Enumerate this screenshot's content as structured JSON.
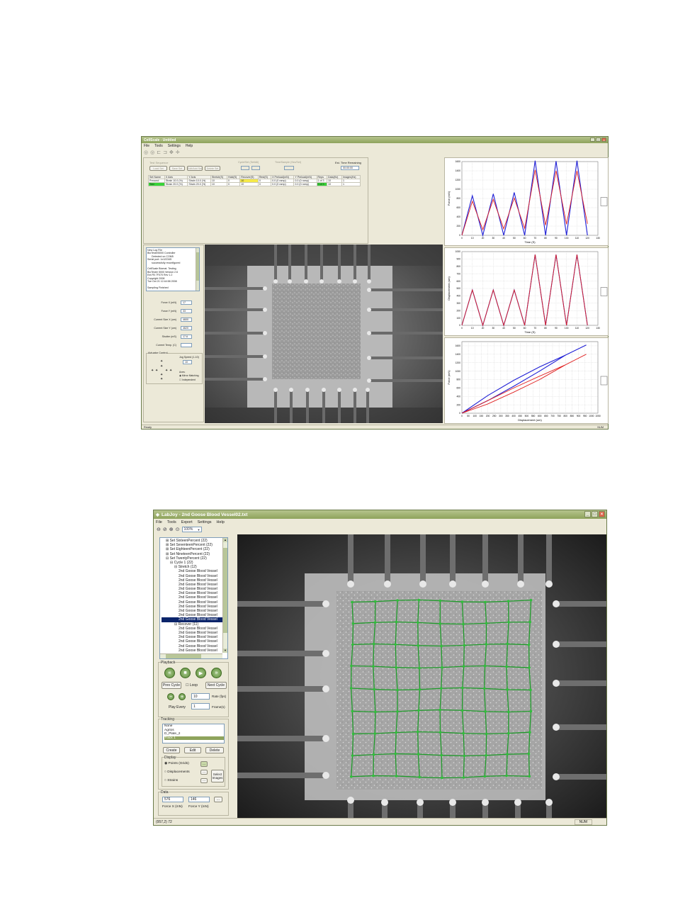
{
  "top_window": {
    "title": "CellScale - Untitled",
    "menu": [
      "File",
      "Tools",
      "Settings",
      "Help"
    ],
    "status": "Ready",
    "status_right": "NUM",
    "header_labels": {
      "test_sequence": "Test Sequence",
      "load_set": "Load Set",
      "save_set": "Save Set",
      "edit_set": "Edit/Add Set",
      "delete_set": "Delete Set",
      "cycle_label": "Cycle/Set (Set/All)",
      "time_label": "Time/Sample (Sec/Set)",
      "est_time_label": "Est. Time Remaining",
      "est_time_value": "00:00:00"
    },
    "table": {
      "headers": [
        "Set Name",
        "X Axis",
        "Y Axis",
        "Stretch(S)",
        "Hold(S)",
        "Recover(S)",
        "Rest(S)",
        "X Preload(mN)",
        "Y Preload(mN)",
        "Reps",
        "Data(Hz)",
        "Images(Hz)"
      ],
      "rows": [
        [
          "Precond",
          "Strain 10.0 (%)",
          "Strain 10.0 (%)",
          "10",
          "0",
          "10",
          "0",
          "0.0 (0 ramp)",
          "0.0 (0 ramp)",
          "1 of 3",
          "10",
          "1"
        ],
        [
          "Test",
          "Strain 20.0 (%)",
          "Strain 20.0 (%)",
          "10",
          "0",
          "10",
          "0",
          "0.0 (0 ramp)",
          "0.0 (0 ramp)",
          "0 of 3",
          "10",
          "1"
        ]
      ]
    },
    "log_lines": [
      "New Log File",
      "BioTester5000 Controller",
      "Detected on COM5",
      "Serial port: 1x122345",
      "successfully reconfigured",
      "",
      "CellScale Biomat. Testing",
      "BioTester 5000 Version 2.6",
      "Ext.FB 7F070 Rev 1.2",
      "Copyright 2008",
      "Tue Oct 21 12:44:58 2008",
      "",
      "Sampling Finished"
    ],
    "readouts": [
      {
        "label": "Force X (mN)",
        "value": "17"
      },
      {
        "label": "Force Y (mN)",
        "value": "33"
      },
      {
        "label": "Current Size X (um)",
        "value": "4600"
      },
      {
        "label": "Current Size Y (um)",
        "value": "4620"
      },
      {
        "label": "Shutter (mS)",
        "value": "17.6"
      },
      {
        "label": "Current Temp. (C)",
        "value": ""
      }
    ],
    "actuator": {
      "title": "Actuator Control",
      "jog_label": "Jog Speed (1-10)",
      "jog_value": "10",
      "axes_label": "Axes:",
      "option_mirror": "Mirror Matching",
      "option_independent": "Independent"
    },
    "charts": {
      "force": {
        "ylabel": "Force (mN)",
        "xlabel": "Time (S)"
      },
      "disp": {
        "ylabel": "Displacement (um)",
        "xlabel": "Time (S)"
      },
      "fvd": {
        "ylabel": "Force (mN)",
        "xlabel": "Displacement (um)"
      }
    }
  },
  "bottom_window": {
    "title": "LabJoy - 2nd Goose Blood Vessel02.txt",
    "menu": [
      "File",
      "Tools",
      "Export",
      "Settings",
      "Help"
    ],
    "zoom": "100%",
    "tree": [
      {
        "text": "Set SixteenPercent (22)",
        "indent": 1,
        "sel": false
      },
      {
        "text": "Set SeventeenPercent (22)",
        "indent": 1,
        "sel": false
      },
      {
        "text": "Set EighteenPercent (22)",
        "indent": 1,
        "sel": false
      },
      {
        "text": "Set NineteenPercent (22)",
        "indent": 1,
        "sel": false
      },
      {
        "text": "Set TwentyPercent (22)",
        "indent": 1,
        "sel": false
      },
      {
        "text": "Cycle 1 (22)",
        "indent": 2,
        "sel": false
      },
      {
        "text": "Stretch (12)",
        "indent": 3,
        "sel": false
      },
      {
        "text": "2nd Goose Blood Vessel",
        "indent": 4,
        "sel": false
      },
      {
        "text": "2nd Goose Blood Vessel",
        "indent": 4,
        "sel": false
      },
      {
        "text": "2nd Goose Blood Vessel",
        "indent": 4,
        "sel": false
      },
      {
        "text": "2nd Goose Blood Vessel",
        "indent": 4,
        "sel": false
      },
      {
        "text": "2nd Goose Blood Vessel",
        "indent": 4,
        "sel": false
      },
      {
        "text": "2nd Goose Blood Vessel",
        "indent": 4,
        "sel": false
      },
      {
        "text": "2nd Goose Blood Vessel",
        "indent": 4,
        "sel": false
      },
      {
        "text": "2nd Goose Blood Vessel",
        "indent": 4,
        "sel": false
      },
      {
        "text": "2nd Goose Blood Vessel",
        "indent": 4,
        "sel": false
      },
      {
        "text": "2nd Goose Blood Vessel",
        "indent": 4,
        "sel": false
      },
      {
        "text": "2nd Goose Blood Vessel",
        "indent": 4,
        "sel": false
      },
      {
        "text": "2nd Goose Blood Vessel",
        "indent": 4,
        "sel": true
      },
      {
        "text": "Recover (11)",
        "indent": 3,
        "sel": false
      },
      {
        "text": "2nd Goose Blood Vessel",
        "indent": 4,
        "sel": false
      },
      {
        "text": "2nd Goose Blood Vessel",
        "indent": 4,
        "sel": false
      },
      {
        "text": "2nd Goose Blood Vessel",
        "indent": 4,
        "sel": false
      },
      {
        "text": "2nd Goose Blood Vessel",
        "indent": 4,
        "sel": false
      },
      {
        "text": "2nd Goose Blood Vessel",
        "indent": 4,
        "sel": false
      },
      {
        "text": "2nd Goose Blood Vessel",
        "indent": 4,
        "sel": false
      }
    ],
    "playback": {
      "title": "Playback",
      "prev_cycle": "Prev Cycle",
      "loop": "Loop",
      "next_cycle": "Next Cycle",
      "rate_value": "10",
      "rate_label": "Rate (fps)",
      "play_every_label": "Play Every",
      "play_every_value": "1",
      "frames_label": "Frame(s)"
    },
    "tracking": {
      "title": "Tracking",
      "items": [
        "None",
        "Agrios",
        "D_Plate_2",
        "Track 1"
      ],
      "selected_index": 3,
      "create": "Create",
      "edit": "Edit",
      "delete": "Delete"
    },
    "display": {
      "title": "Display",
      "points": "Points (Grids)",
      "displacements": "Displacements",
      "strains": "Strains",
      "select_images": "Select Images",
      "more": "..."
    },
    "data": {
      "title": "Data",
      "force_x_value": "576",
      "force_y_value": "146",
      "force_x_label": "Force X (mN)",
      "force_y_label": "Force Y (mN)",
      "more": "..."
    },
    "status": "(957,2) 72",
    "status_right": "NUM"
  },
  "chart_data": [
    {
      "type": "line",
      "ylabel": "Force (mN)",
      "xlabel": "Time (S)",
      "xlim": [
        0,
        130
      ],
      "ylim": [
        0,
        1600
      ],
      "x": [
        0,
        10,
        20,
        30,
        40,
        50,
        60,
        70,
        80,
        90,
        100,
        110,
        120
      ],
      "series": [
        {
          "values": [
            0,
            860,
            0,
            900,
            0,
            930,
            0,
            1620,
            0,
            1610,
            0,
            1620,
            0
          ],
          "color": "#1f1fd6"
        },
        {
          "values": [
            0,
            740,
            120,
            780,
            140,
            810,
            150,
            1420,
            220,
            1400,
            240,
            1400,
            250
          ],
          "color": "#e02020"
        }
      ]
    },
    {
      "type": "line",
      "ylabel": "Displacement (um)",
      "xlabel": "Time (S)",
      "xlim": [
        0,
        130
      ],
      "ylim": [
        0,
        1000
      ],
      "x": [
        0,
        10,
        20,
        30,
        40,
        50,
        60,
        70,
        80,
        90,
        100,
        110,
        120
      ],
      "series": [
        {
          "values": [
            0,
            480,
            0,
            480,
            0,
            480,
            0,
            960,
            0,
            960,
            0,
            960,
            0
          ],
          "color": "#1f1fd6"
        },
        {
          "values": [
            0,
            480,
            0,
            480,
            0,
            480,
            0,
            960,
            0,
            960,
            0,
            960,
            0
          ],
          "color": "#e02020"
        }
      ]
    },
    {
      "type": "line",
      "ylabel": "Force (mN)",
      "xlabel": "Displacement (um)",
      "xlim": [
        0,
        1050
      ],
      "ylim": [
        0,
        1700
      ],
      "series": [
        {
          "x": [
            0,
            200,
            400,
            600,
            800,
            960,
            800,
            600,
            400,
            200,
            0
          ],
          "values": [
            0,
            420,
            780,
            1100,
            1380,
            1620,
            1380,
            1000,
            640,
            300,
            0
          ],
          "color": "#1f1fd6"
        },
        {
          "x": [
            0,
            200,
            400,
            600,
            800,
            960,
            800,
            600,
            400,
            200,
            0
          ],
          "values": [
            0,
            300,
            600,
            880,
            1150,
            1400,
            1150,
            800,
            500,
            220,
            0
          ],
          "color": "#e02020"
        }
      ]
    }
  ]
}
